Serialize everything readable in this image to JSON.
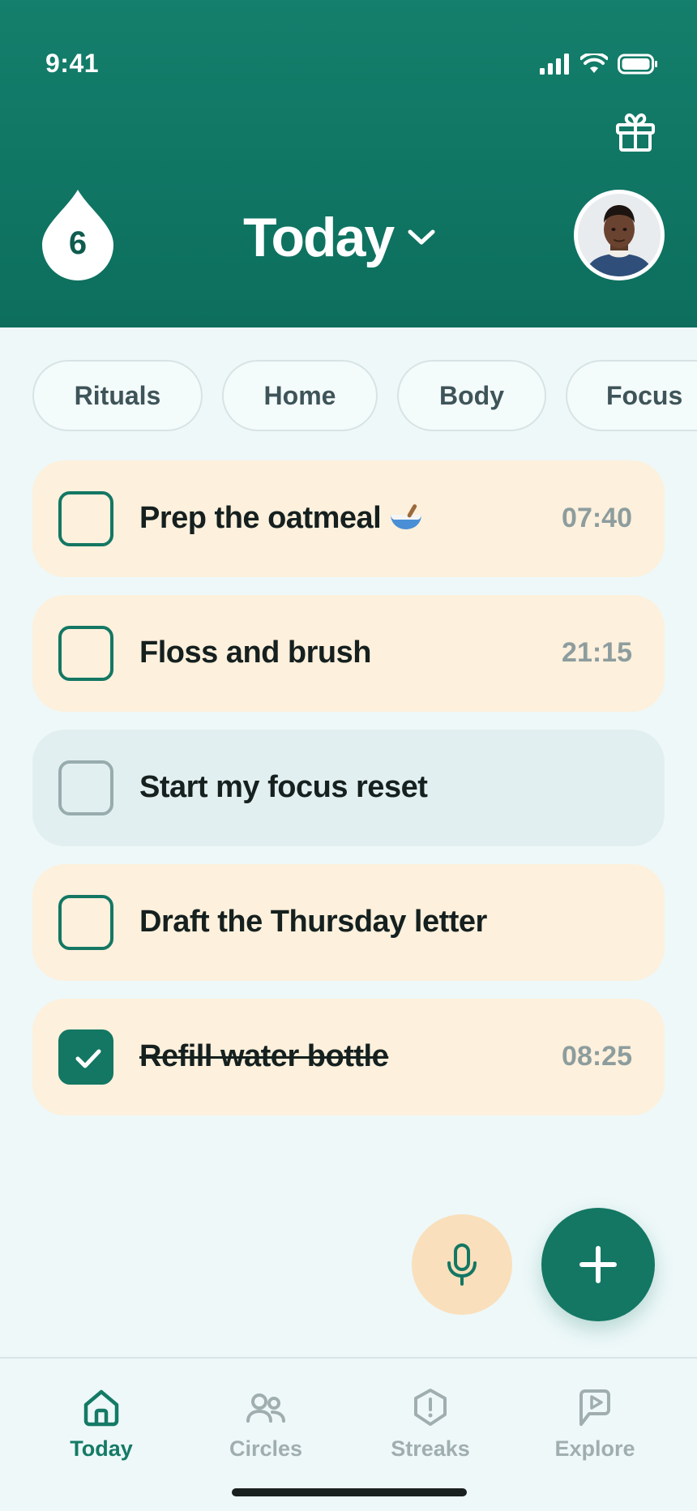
{
  "status_bar": {
    "time": "9:41"
  },
  "header": {
    "streak_count": "6",
    "title": "Today",
    "icons": [
      "gift-icon",
      "chevron-down-icon",
      "avatar"
    ]
  },
  "chips": [
    "Rituals",
    "Home",
    "Body",
    "Focus"
  ],
  "tasks": [
    {
      "label": "Prep the oatmeal",
      "emoji_icon": "bowl-icon",
      "time": "07:40",
      "checked": false,
      "style": "warm"
    },
    {
      "label": "Floss and brush",
      "time": "21:15",
      "checked": false,
      "style": "warm"
    },
    {
      "label": "Start my focus reset",
      "time": "",
      "checked": false,
      "style": "grey"
    },
    {
      "label": "Draft the Thursday letter",
      "time": "",
      "checked": false,
      "style": "warm"
    },
    {
      "label": "Refill water bottle",
      "time": "08:25",
      "checked": true,
      "style": "warm"
    }
  ],
  "actions": {
    "mic": "mic-icon",
    "add": "plus-icon"
  },
  "tabbar": [
    {
      "label": "Today",
      "icon": "home-icon",
      "active": true
    },
    {
      "label": "Circles",
      "icon": "people-icon",
      "active": false
    },
    {
      "label": "Streaks",
      "icon": "shield-alert-icon",
      "active": false
    },
    {
      "label": "Explore",
      "icon": "play-bubble-icon",
      "active": false
    }
  ],
  "colors": {
    "brand": "#137763",
    "header_bg": "#147f6c",
    "warm_card": "#fdf0dc",
    "grey_card": "#e2eff0",
    "page_bg": "#eef8f9",
    "mic_bg": "#f9dfbb"
  }
}
